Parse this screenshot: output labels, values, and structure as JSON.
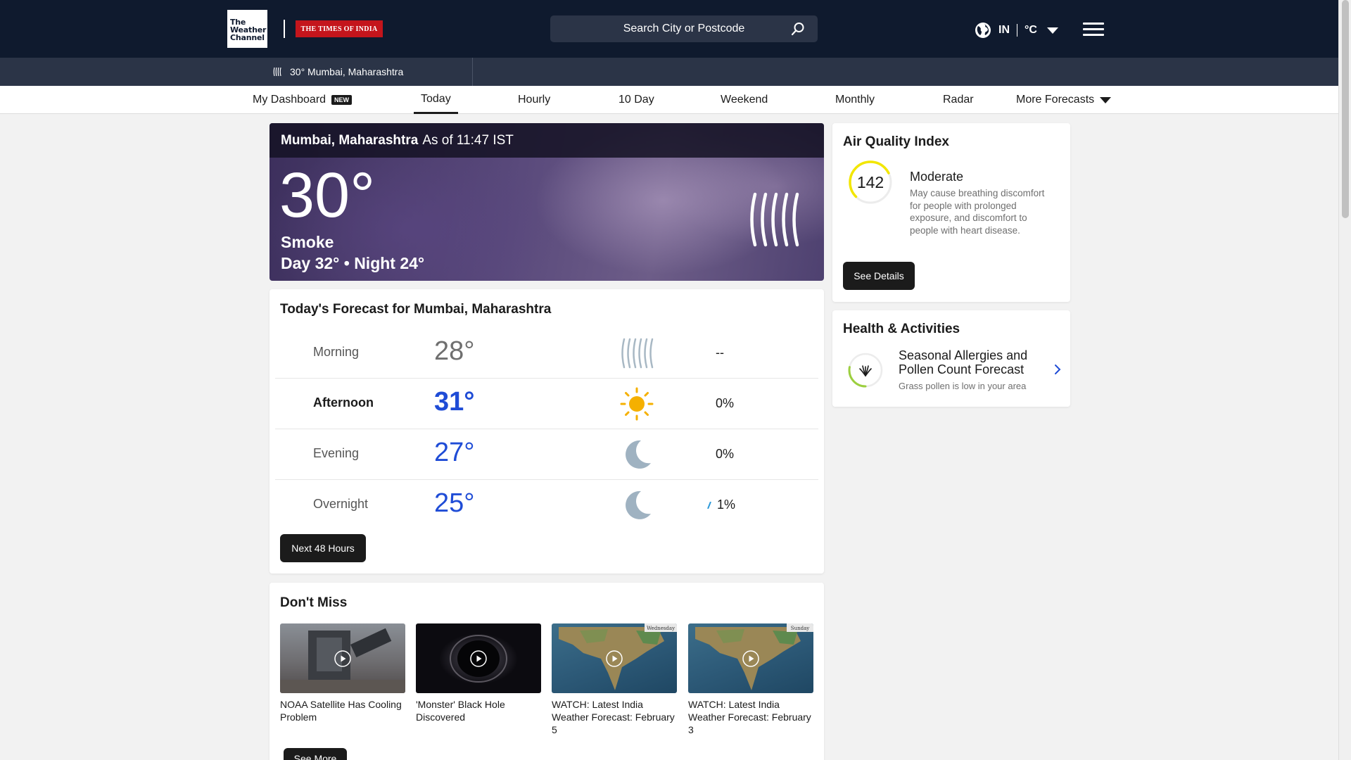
{
  "header": {
    "logo_twc": "The Weather Channel",
    "logo_toi": "THE TIMES OF INDIA",
    "search_placeholder": "Search City or Postcode",
    "region": "IN",
    "unit": "°C"
  },
  "subbar": {
    "recent_location": "30° Mumbai, Maharashtra"
  },
  "nav": {
    "items": [
      {
        "label": "My Dashboard",
        "badge": "NEW"
      },
      {
        "label": "Today"
      },
      {
        "label": "Hourly"
      },
      {
        "label": "10 Day"
      },
      {
        "label": "Weekend"
      },
      {
        "label": "Monthly"
      },
      {
        "label": "Radar"
      },
      {
        "label": "More Forecasts"
      }
    ],
    "active": "Today"
  },
  "current": {
    "location": "Mumbai, Maharashtra",
    "as_of": "As of 11:47 IST",
    "temp": "30°",
    "phrase": "Smoke",
    "day_night": "Day 32° • Night 24°",
    "icon": "smoke-icon"
  },
  "today_forecast": {
    "title": "Today's Forecast for Mumbai, Maharashtra",
    "rows": [
      {
        "label": "Morning",
        "temp": "28°",
        "icon": "smoke-icon",
        "precip": "--"
      },
      {
        "label": "Afternoon",
        "temp": "31°",
        "icon": "sun-icon",
        "precip": "0%"
      },
      {
        "label": "Evening",
        "temp": "27°",
        "icon": "moon-icon",
        "precip": "0%"
      },
      {
        "label": "Overnight",
        "temp": "25°",
        "icon": "moon-icon",
        "precip": "1%"
      }
    ],
    "button": "Next 48 Hours"
  },
  "aqi": {
    "title": "Air Quality Index",
    "value": "142",
    "category": "Moderate",
    "description": "May cause breathing discomfort for people with prolonged exposure, and discomfort to people with heart disease.",
    "button": "See Details",
    "ring_color": "#f2e600"
  },
  "health": {
    "title": "Health & Activities",
    "item_title": "Seasonal Allergies and Pollen Count Forecast",
    "item_subtitle": "Grass pollen is low in your area",
    "ring_color": "#9ccf3f"
  },
  "dont_miss": {
    "title": "Don't Miss",
    "items": [
      {
        "caption": "NOAA Satellite Has Cooling Problem"
      },
      {
        "caption": "'Monster' Black Hole Discovered"
      },
      {
        "caption": "WATCH: Latest India Weather Forecast: February 5",
        "map_label": "Wednesday"
      },
      {
        "caption": "WATCH: Latest India Weather Forecast: February 3",
        "map_label": "Sunday"
      }
    ],
    "button": "See More"
  },
  "colors": {
    "header_bg": "#0f1a2e",
    "subbar_bg": "#2b3447",
    "accent_temp": "#1f4cd6"
  }
}
